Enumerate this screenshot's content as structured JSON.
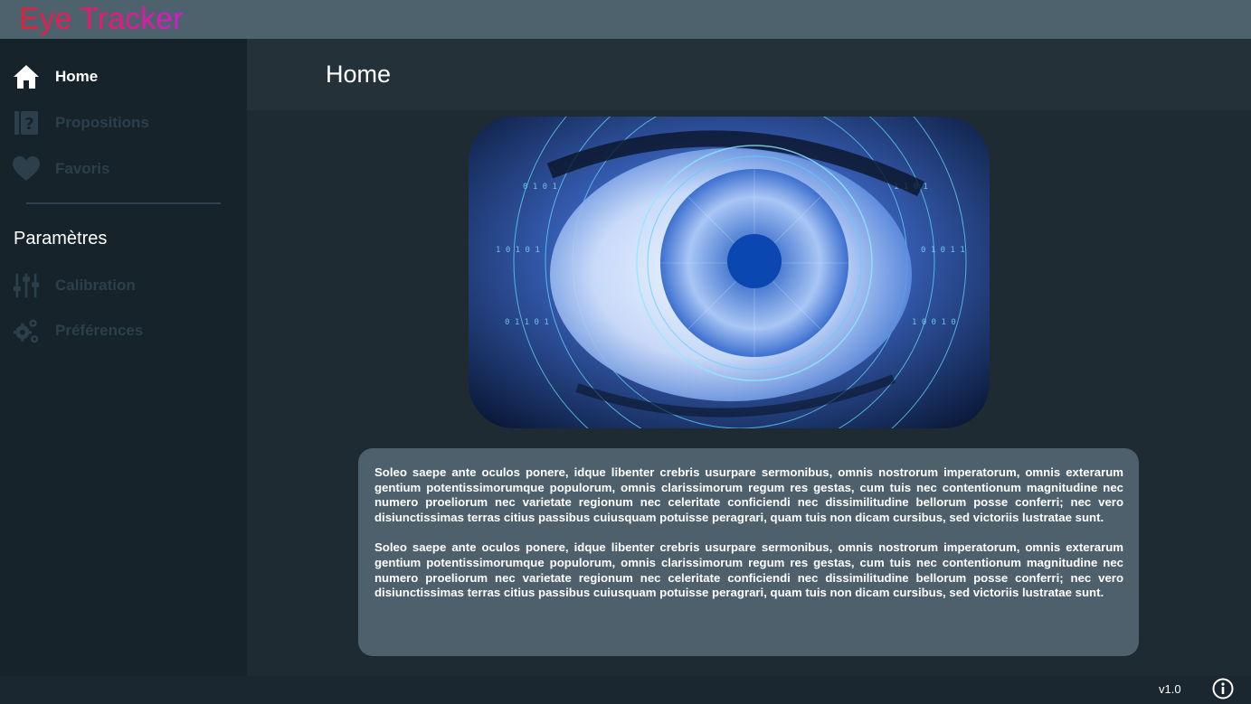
{
  "app": {
    "title": "Eye Tracker",
    "version": "v1.0"
  },
  "sidebar": {
    "items": [
      {
        "label": "Home",
        "icon": "home-icon",
        "state": "active"
      },
      {
        "label": "Propositions",
        "icon": "question-book-icon",
        "state": "disabled"
      },
      {
        "label": "Favoris",
        "icon": "heart-icon",
        "state": "disabled"
      }
    ],
    "section_title": "Paramètres",
    "settings_items": [
      {
        "label": "Calibration",
        "icon": "sliders-icon",
        "state": "disabled"
      },
      {
        "label": "Préférences",
        "icon": "gears-icon",
        "state": "disabled"
      }
    ]
  },
  "main": {
    "title": "Home",
    "hero_image": "eye-digital-image",
    "paragraphs": [
      "Soleo saepe ante oculos ponere, idque libenter crebris usurpare sermonibus, omnis nostrorum imperatorum, omnis exterarum gentium potentissimorumque populorum, omnis clarissimorum regum res gestas, cum tuis nec contentionum magnitudine nec numero proeliorum nec varietate regionum nec celeritate conficiendi nec dissimilitudine bellorum posse conferri; nec vero disiunctissimas terras citius passibus cuiusquam potuisse peragrari, quam tuis non dicam cursibus, sed victoriis lustratae sunt.",
      "Soleo saepe ante oculos ponere, idque libenter crebris usurpare sermonibus, omnis nostrorum imperatorum, omnis exterarum gentium potentissimorumque populorum, omnis clarissimorum regum res gestas, cum tuis nec contentionum magnitudine nec numero proeliorum nec varietate regionum nec celeritate conficiendi nec dissimilitudine bellorum posse conferri; nec vero disiunctissimas terras citius passibus cuiusquam potuisse peragrari, quam tuis non dicam cursibus, sed victoriis lustratae sunt."
    ]
  },
  "colors": {
    "topbar": "#4d626d",
    "sidebar": "#17232b",
    "content": "#1f2b33",
    "card": "#4e606b",
    "title_gradient_start": "#e0233a",
    "title_gradient_end": "#d61ad4",
    "disabled": "#2c3f4a"
  }
}
